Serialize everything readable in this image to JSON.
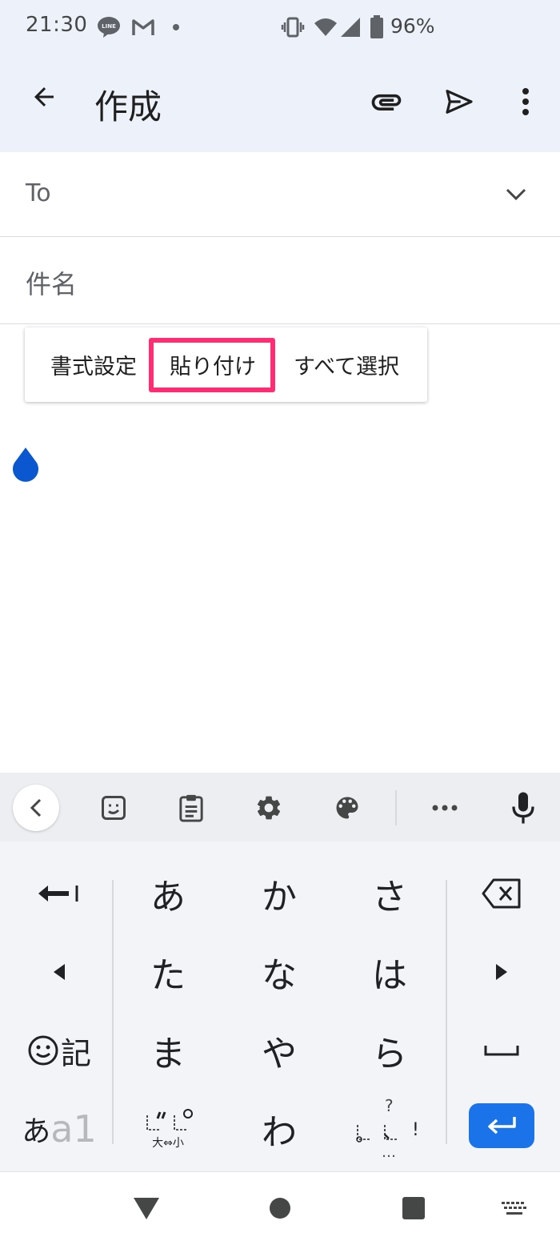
{
  "status_bar": {
    "time": "21:30",
    "battery": "96%",
    "icons": [
      "line-icon",
      "gmail-icon",
      "dot-icon",
      "vibrate-icon",
      "wifi-icon",
      "signal-icon",
      "battery-icon"
    ]
  },
  "app_bar": {
    "title": "作成"
  },
  "fields": {
    "to_label": "To",
    "subject_label": "件名"
  },
  "context_menu": {
    "items": [
      "書式設定",
      "貼り付け",
      "すべて選択"
    ],
    "highlight_color": "#ff2d73"
  },
  "keyboard": {
    "rows": [
      [
        "あ",
        "か",
        "さ"
      ],
      [
        "た",
        "な",
        "は"
      ],
      [
        "ま",
        "や",
        "ら"
      ],
      [
        "",
        "わ",
        ""
      ]
    ],
    "emoji_key": "記",
    "mode_key_a": "あ",
    "mode_key_b": "a1",
    "dakuten_bottom": "大⇔小",
    "punct_top": "?",
    "punct_dots": "…",
    "punct_excl": "!",
    "accent": "#1a73e8"
  },
  "colors": {
    "appbar_bg": "#edf2fa",
    "cursor": "#0b57d0"
  }
}
